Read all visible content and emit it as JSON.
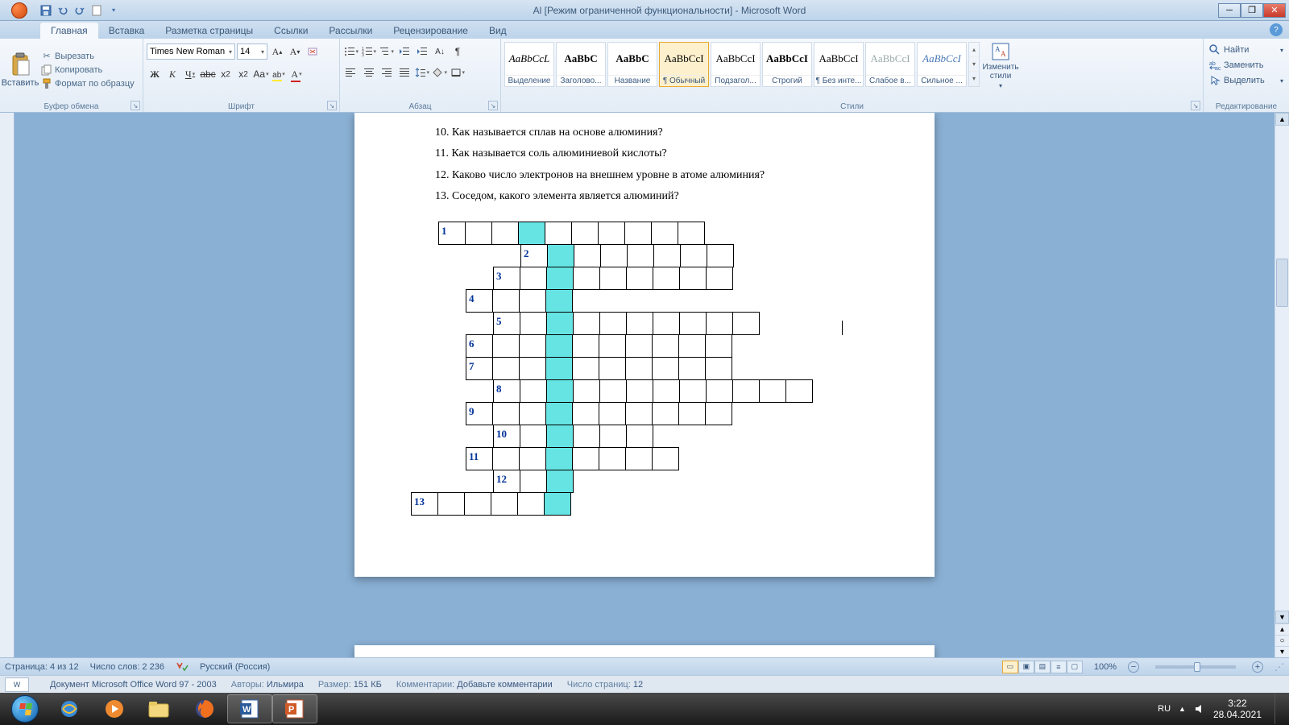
{
  "titlebar": {
    "title": "Al [Режим ограниченной функциональности] - Microsoft Word"
  },
  "tabs": {
    "items": [
      "Главная",
      "Вставка",
      "Разметка страницы",
      "Ссылки",
      "Рассылки",
      "Рецензирование",
      "Вид"
    ],
    "active": 0
  },
  "ribbon": {
    "clipboard": {
      "paste": "Вставить",
      "cut": "Вырезать",
      "copy": "Копировать",
      "format_painter": "Формат по образцу",
      "label": "Буфер обмена"
    },
    "font": {
      "name": "Times New Roman",
      "size": "14",
      "label": "Шрифт"
    },
    "paragraph": {
      "label": "Абзац"
    },
    "styles": {
      "items": [
        {
          "preview": "AaBbCcL",
          "name": "Выделение",
          "i": true
        },
        {
          "preview": "AaBbC",
          "name": "Заголово...",
          "b": true
        },
        {
          "preview": "AaBbC",
          "name": "Название",
          "b": true
        },
        {
          "preview": "AaBbCcI",
          "name": "¶ Обычный"
        },
        {
          "preview": "AaBbCcI",
          "name": "Подзагол..."
        },
        {
          "preview": "AaBbCcI",
          "name": "Строгий",
          "b": true
        },
        {
          "preview": "AaBbCcI",
          "name": "¶ Без инте..."
        },
        {
          "preview": "AaBbCcI",
          "name": "Слабое в...",
          "color": "#9aa"
        },
        {
          "preview": "AaBbCcI",
          "name": "Сильное ...",
          "i": true,
          "color": "#4a7ab8"
        }
      ],
      "active": 3,
      "change": "Изменить стили",
      "label": "Стили"
    },
    "editing": {
      "find": "Найти",
      "replace": "Заменить",
      "select": "Выделить",
      "label": "Редактирование"
    }
  },
  "document": {
    "questions": [
      "10. Как называется сплав на основе алюминия?",
      "11. Как называется соль алюминиевой кислоты?",
      "12. Каково число электронов на внешнем уровне в атоме алюминия?",
      "13. Соседом, какого элемента является алюминий?"
    ],
    "crossword_rows": [
      {
        "num": "1",
        "start": 1,
        "len": 10,
        "hl": 4,
        "y": 0
      },
      {
        "num": "2",
        "start": 4,
        "len": 8,
        "hl": 5,
        "y": 1
      },
      {
        "num": "3",
        "start": 3,
        "len": 9,
        "hl": 5,
        "y": 2
      },
      {
        "num": "4",
        "start": 2,
        "len": 4,
        "hl": 5,
        "y": 3
      },
      {
        "num": "5",
        "start": 3,
        "len": 10,
        "hl": 5,
        "y": 4
      },
      {
        "num": "6",
        "start": 2,
        "len": 10,
        "hl": 5,
        "y": 5
      },
      {
        "num": "7",
        "start": 2,
        "len": 10,
        "hl": 5,
        "y": 6
      },
      {
        "num": "8",
        "start": 3,
        "len": 12,
        "hl": 5,
        "y": 7
      },
      {
        "num": "9",
        "start": 2,
        "len": 10,
        "hl": 5,
        "y": 8
      },
      {
        "num": "10",
        "start": 3,
        "len": 6,
        "hl": 5,
        "y": 9
      },
      {
        "num": "11",
        "start": 2,
        "len": 8,
        "hl": 5,
        "y": 10
      },
      {
        "num": "12",
        "start": 3,
        "len": 3,
        "hl": 5,
        "y": 11
      },
      {
        "num": "13",
        "start": 0,
        "len": 6,
        "hl": 5,
        "y": 12
      }
    ]
  },
  "statusbar": {
    "page": "Страница: 4 из 12",
    "words": "Число слов: 2 236",
    "lang": "Русский (Россия)",
    "zoom": "100%"
  },
  "infobar": {
    "doc": "Документ Microsoft Office Word 97 - 2003",
    "authors_lbl": "Авторы:",
    "authors": "Ильмира",
    "size_lbl": "Размер:",
    "size": "151 КБ",
    "comments_lbl": "Комментарии:",
    "comments": "Добавьте комментарии",
    "pages_lbl": "Число страниц:",
    "pages": "12"
  },
  "tray": {
    "lang": "RU",
    "time": "3:22",
    "date": "28.04.2021"
  }
}
